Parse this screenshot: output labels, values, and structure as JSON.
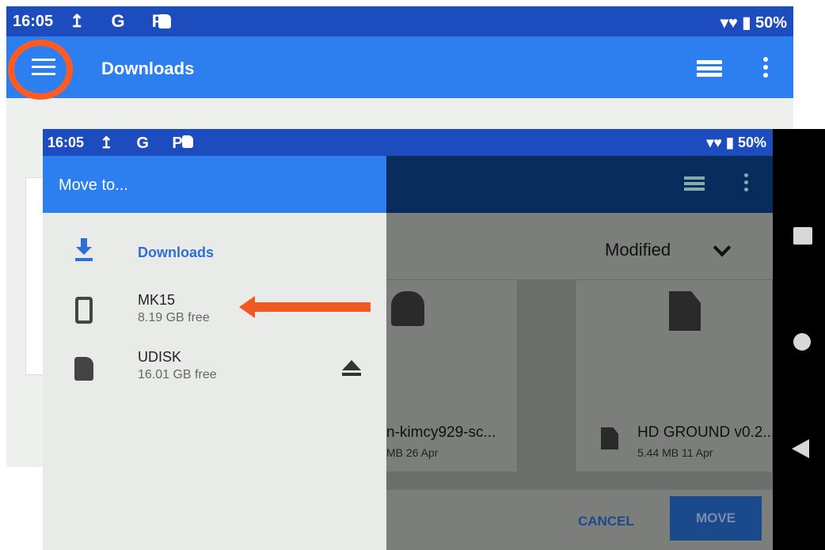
{
  "background_screen": {
    "status_bar": {
      "time": "16:05",
      "icons": "↥ G P",
      "battery": "50%"
    },
    "app_bar": {
      "title": "Downloads"
    }
  },
  "foreground_screen": {
    "status_bar": {
      "time": "16:05",
      "icons": "↥ G P",
      "battery": "50%"
    },
    "drawer": {
      "title": "Move to...",
      "items": [
        {
          "label": "Downloads",
          "subtitle": ""
        },
        {
          "label": "MK15",
          "subtitle": "8.19 GB free"
        },
        {
          "label": "UDISK",
          "subtitle": "16.01 GB free"
        }
      ]
    },
    "sort": {
      "label": "Modified"
    },
    "files": [
      {
        "name": "n-kimcy929-sc...",
        "meta": "MB 26 Apr"
      },
      {
        "name": "HD GROUND v0.2...",
        "meta": "5.44 MB 11 Apr"
      }
    ],
    "actions": {
      "cancel": "CANCEL",
      "move": "MOVE"
    }
  },
  "colors": {
    "status_bar": "#1d4cbf",
    "app_bar": "#2d7ff0",
    "highlight": "#ff5a1f",
    "dark_app_bar": "#082c5c"
  }
}
